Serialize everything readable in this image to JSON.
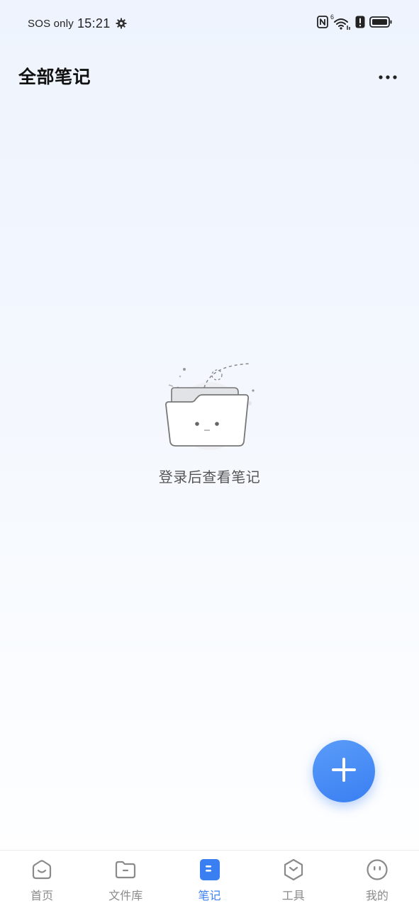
{
  "status_bar": {
    "carrier": "SOS only",
    "time": "15:21",
    "icons": [
      "gear-icon",
      "nfc-icon",
      "wifi-icon",
      "alert-icon",
      "battery-icon"
    ],
    "network_badge": "6"
  },
  "header": {
    "title": "全部笔记",
    "more_icon": "more-dots-icon"
  },
  "empty_state": {
    "illustration": "empty-folder-icon",
    "message": "登录后查看笔记"
  },
  "fab": {
    "icon": "plus-icon"
  },
  "bottom_nav": {
    "active_index": 2,
    "items": [
      {
        "label": "首页",
        "icon": "home-icon"
      },
      {
        "label": "文件库",
        "icon": "folder-icon"
      },
      {
        "label": "笔记",
        "icon": "note-icon"
      },
      {
        "label": "工具",
        "icon": "tools-icon"
      },
      {
        "label": "我的",
        "icon": "profile-icon"
      }
    ]
  },
  "colors": {
    "accent": "#3a7ff2",
    "inactive": "#8a8a8a",
    "title": "#111111"
  }
}
